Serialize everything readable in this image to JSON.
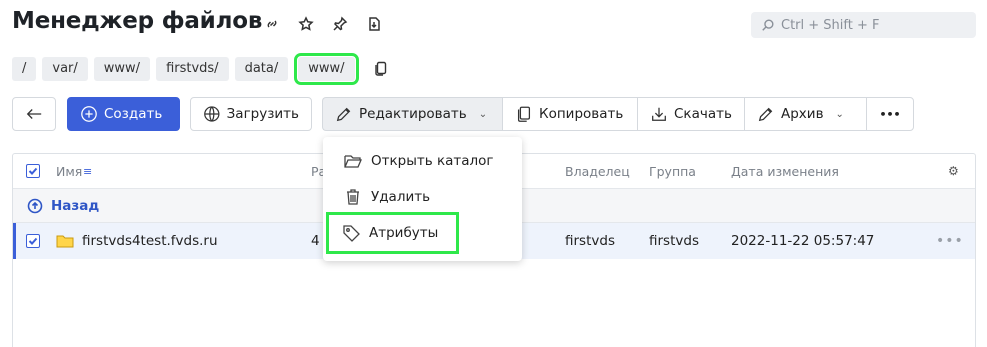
{
  "page": {
    "title": "Менеджер файлов",
    "search_placeholder": "Ctrl + Shift + F"
  },
  "breadcrumbs": [
    "/",
    "var/",
    "www/",
    "firstvds/",
    "data/",
    "www/"
  ],
  "toolbar": {
    "create": "Создать",
    "upload": "Загрузить",
    "edit": "Редактировать",
    "copy": "Копировать",
    "download": "Скачать",
    "archive": "Архив",
    "more": "•••"
  },
  "table": {
    "headers": {
      "name": "Имя",
      "size": "Ра",
      "owner": "Владелец",
      "group": "Группа",
      "modified": "Дата изменения"
    },
    "back": "Назад",
    "rows": [
      {
        "name": "firstvds4test.fvds.ru",
        "size": "4",
        "owner": "firstvds",
        "group": "firstvds",
        "modified": "2022-11-22 05:57:47",
        "more": "•••"
      }
    ]
  },
  "menu": {
    "items": [
      "Открыть каталог",
      "Удалить",
      "Атрибуты"
    ]
  },
  "colors": {
    "accent": "#3b5fd9",
    "highlight": "#2ee84a",
    "selected_row": "#eef3fc"
  }
}
